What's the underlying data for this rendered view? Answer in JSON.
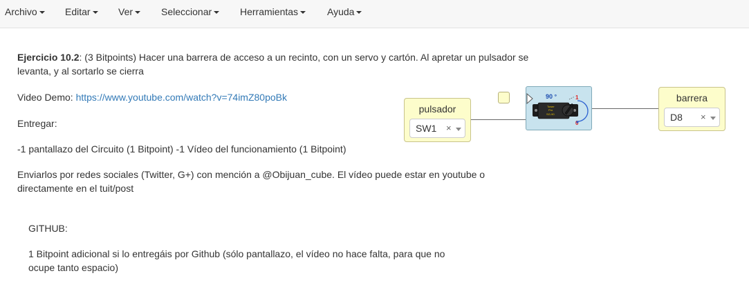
{
  "menu": {
    "archivo": "Archivo",
    "editar": "Editar",
    "ver": "Ver",
    "seleccionar": "Seleccionar",
    "herramientas": "Herramientas",
    "ayuda": "Ayuda"
  },
  "description": {
    "title_bold": "Ejercicio 10.2",
    "title_rest": ": (3 Bitpoints) Hacer una barrera de acceso a un recinto, con un servo y cartón. Al apretar un pulsador se levanta, y al sortarlo se cierra",
    "video_label": "Video Demo: ",
    "video_url": "https://www.youtube.com/watch?v=74imZ80poBk",
    "entregar": "Entregar:",
    "items": "-1 pantallazo del Circuito (1 Bitpoint) -1 Vídeo del funcionamiento (1 Bitpoint)",
    "enviarlos": "Enviarlos por redes sociales (Twitter, G+) con mención a @Obijuan_cube. El vídeo puede estar en youtube o directamente en el tuit/post",
    "github": "GITHUB:",
    "github_note": "1 Bitpoint adicional si lo entregáis por Github (sólo pantallazo, el vídeo no hace falta, para que no ocupe tanto espacio)"
  },
  "circuit": {
    "pulsador": {
      "title": "pulsador",
      "value": "SW1",
      "clear": "×"
    },
    "barrera": {
      "title": "barrera",
      "value": "D8",
      "clear": "×"
    },
    "servo": {
      "angle_label": "90 °",
      "mark_top": "1",
      "mark_bottom": "0",
      "body_text": [
        "Tower",
        "Pro",
        "SG-90"
      ]
    }
  },
  "colors": {
    "block_bg": "#fdfdcb",
    "servo_bg": "#c8e3ee",
    "link": "#337ab7",
    "arrow_blue": "#2a5fd0",
    "marker_red": "#e02020"
  }
}
